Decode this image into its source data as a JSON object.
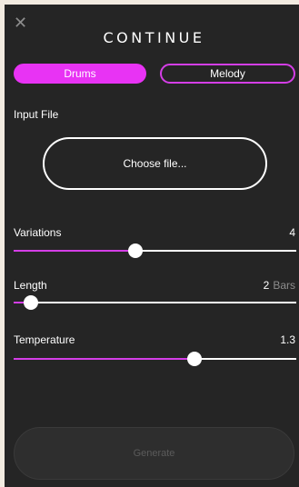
{
  "header": {
    "close_glyph": "✕",
    "title": "CONTINUE"
  },
  "tabs": [
    {
      "label": "Drums",
      "active": true
    },
    {
      "label": "Melody",
      "active": false
    }
  ],
  "input_file": {
    "label": "Input File",
    "button_label": "Choose file..."
  },
  "sliders": {
    "variations": {
      "label": "Variations",
      "value": "4",
      "fraction": 0.43
    },
    "length": {
      "label": "Length",
      "value": "2",
      "unit": "Bars",
      "fraction": 0.06
    },
    "temperature": {
      "label": "Temperature",
      "value": "1.3",
      "fraction": 0.64
    }
  },
  "generate": {
    "label": "Generate",
    "enabled": false
  },
  "colors": {
    "accent": "#e833f4",
    "background": "#252525",
    "page": "#f2ebe1"
  }
}
